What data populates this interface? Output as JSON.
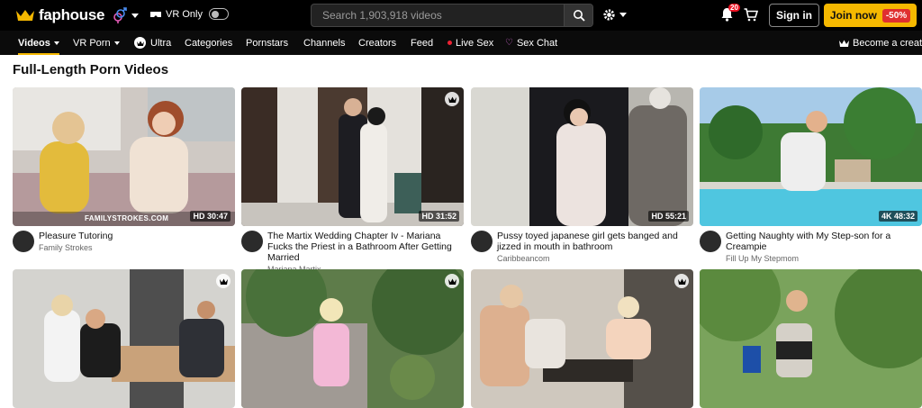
{
  "header": {
    "brand": "faphouse",
    "vr_only_label": "VR Only",
    "search_placeholder": "Search 1,903,918 videos",
    "notification_count": "20",
    "sign_in_label": "Sign in",
    "join_label": "Join now",
    "join_discount": "-50%",
    "accent_color": "#f5b800"
  },
  "nav": {
    "items": [
      {
        "label": "Videos"
      },
      {
        "label": "VR Porn"
      },
      {
        "label": "Ultra"
      },
      {
        "label": "Categories"
      },
      {
        "label": "Pornstars"
      },
      {
        "label": "Channels"
      },
      {
        "label": "Creators"
      },
      {
        "label": "Feed"
      },
      {
        "label": "Live Sex"
      },
      {
        "label": "Sex Chat"
      }
    ],
    "become_creator": "Become a creator"
  },
  "page_title": "Full-Length Porn Videos",
  "videos": [
    {
      "title": "Pleasure Tutoring",
      "channel": "Family Strokes",
      "quality_duration": "HD 30:47",
      "watermark": "FAMILYSTROKES.COM"
    },
    {
      "title": "The Martix Wedding Chapter Iv - Mariana Fucks the Priest in a Bathroom After Getting Married",
      "channel": "Mariana Martix",
      "quality_duration": "HD 31:52"
    },
    {
      "title": "Pussy toyed japanese girl gets banged and jizzed in mouth in bathroom",
      "channel": "Caribbeancom",
      "quality_duration": "HD 55:21"
    },
    {
      "title": "Getting Naughty with My Step-son for a Creampie",
      "channel": "Fill Up My Stepmom",
      "quality_duration": "4K 48:32"
    }
  ]
}
